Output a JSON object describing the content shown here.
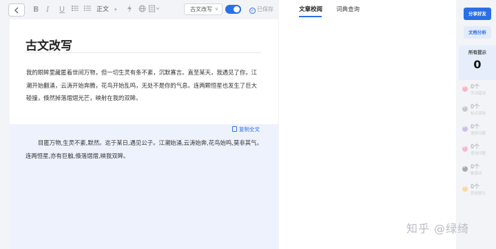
{
  "toolbar": {
    "back_icon": "chevron-left-icon",
    "format_items": [
      "B",
      "I",
      "U"
    ],
    "paragraph_style": "正文",
    "mode_select": "古文改写",
    "toggle_on": true,
    "saved_status": "已保存"
  },
  "document": {
    "title": "古文改写",
    "paragraph": "我的眼眸里藏匿着世间万物，但一切生灵有条不紊，沉默寡言。直至某天，我遇见了你，江潮开始翻涌，云涛开始奔腾，花鸟开始乱鸣，无处不是你的气息。连两颗恒星也发生了巨大碰撞，倏然掉落熠熠光芒，映射在我的双眸。"
  },
  "result": {
    "copy_all_label": "复制全文",
    "text": "目匿万物,生灵不紊,默然。迄于某日,遇见公子。江潮始涌,云涛始奔,花鸟始鸣,莫非其气。连两恒星,亦有巨触,倏落熠熠,映我双眸。"
  },
  "mid_tabs": [
    {
      "label": "文章校阅",
      "active": true
    },
    {
      "label": "词典查询",
      "active": false
    }
  ],
  "watermark": "知乎 @绿绮",
  "sidebar": {
    "share_button": "分享好友",
    "analysis_button": "文档分析",
    "issues_label": "所有提示",
    "issues_total": "0",
    "categories": [
      {
        "count": "0个",
        "name": "字词错误",
        "color": "#f4b9c4"
      },
      {
        "count": "0个",
        "name": "标点误用",
        "color": "#c7c9cf"
      },
      {
        "count": "0个",
        "name": "语序问题",
        "color": "#cdbef2"
      },
      {
        "count": "0个",
        "name": "语法问题",
        "color": "#f4b9d4"
      },
      {
        "count": "0个",
        "name": "敏感词",
        "color": "#a8aab0"
      },
      {
        "count": "0个",
        "name": "其他提示",
        "color": "#f6d9a8"
      }
    ]
  },
  "colors": {
    "accent": "#2b6fe6",
    "panel": "#eef2fc"
  }
}
